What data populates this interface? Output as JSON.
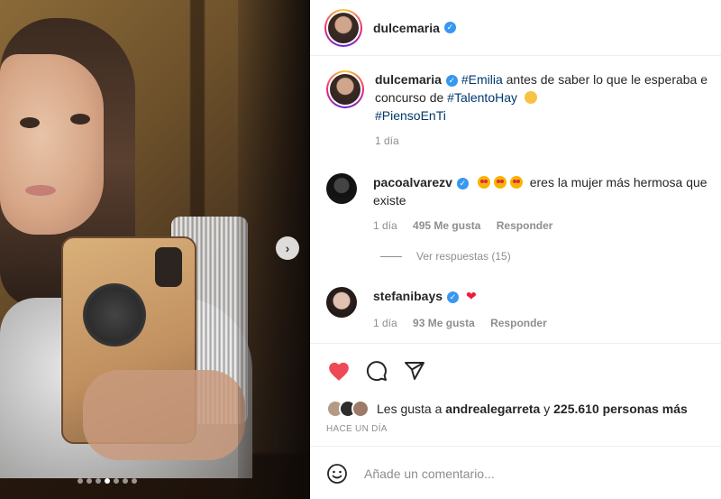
{
  "post": {
    "username": "dulcemaria",
    "caption_hashtag_1": "#Emilia",
    "caption_text_1": " antes de saber lo que le esperaba e",
    "caption_text_2": "concurso de ",
    "caption_hashtag_2": "#TalentoHay",
    "caption_hashtag_3": "#PiensoEnTi",
    "caption_time": "1 día"
  },
  "comments": [
    {
      "username": "pacoalvarezv",
      "text_1": "eres la mujer más hermosa que",
      "text_2": "existe",
      "time": "1 día",
      "likes": "495 Me gusta",
      "reply": "Responder"
    },
    {
      "username": "stefanibays",
      "time": "1 día",
      "likes": "93 Me gusta",
      "reply": "Responder"
    }
  ],
  "view_replies": "Ver respuestas (15)",
  "likes": {
    "prefix": "Les gusta a ",
    "user": "andrealegarreta",
    "middle": " y ",
    "count": "225.610 personas más"
  },
  "time_ago": "HACE UN DÍA",
  "comment_placeholder": "Añade un comentario...",
  "carousel": {
    "total": 7,
    "active_index": 3
  },
  "icons": [
    "verified-badge",
    "heart-filled",
    "comment-bubble",
    "share-paper-plane",
    "smiley-emoji",
    "chevron-right"
  ],
  "colors": {
    "heart": "#ed4956",
    "hashtag": "#00376b",
    "verified": "#3897f0"
  }
}
